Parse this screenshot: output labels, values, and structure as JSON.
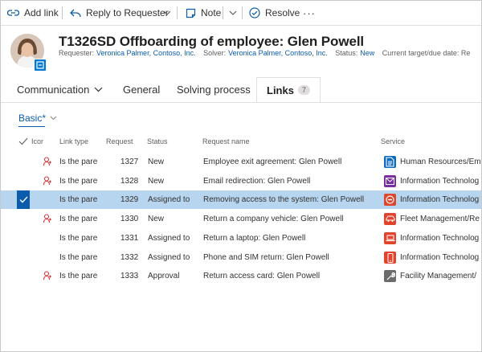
{
  "toolbar": {
    "add_link": "Add link",
    "reply": "Reply to Requester",
    "note": "Note",
    "resolve": "Resolve",
    "more": "···"
  },
  "header": {
    "title": "T1326SD Offboarding of employee: Glen Powell",
    "requester_label": "Requester:",
    "requester": "Veronica Palmer, Contoso, Inc.",
    "solver_label": "Solver:",
    "solver": "Veronica Palmer, Contoso, Inc.",
    "status_label": "Status:",
    "status": "New",
    "target_label": "Current target/due date: Re"
  },
  "tabs": [
    {
      "label": "Communication"
    },
    {
      "label": "General"
    },
    {
      "label": "Solving process"
    },
    {
      "label": "Links",
      "badge": "7"
    }
  ],
  "view": {
    "label": "Basic*"
  },
  "columns": {
    "icon": "Icor",
    "link_type": "Link type",
    "request": "Request",
    "status": "Status",
    "request_name": "Request name",
    "service": "Service"
  },
  "rows": [
    {
      "person": true,
      "link_type": "Is the pare",
      "request": "1327",
      "status": "New",
      "name": "Employee exit agreement: Glen Powell",
      "service": "Human Resources/Em",
      "service_icon": "document-icon",
      "service_color": "#0f6cbd"
    },
    {
      "person": true,
      "link_type": "Is the pare",
      "request": "1328",
      "status": "New",
      "name": "Email redirection: Glen Powell",
      "service": "Information Technolog",
      "service_icon": "mail-icon",
      "service_color": "#7a2ea0"
    },
    {
      "person": false,
      "selected": true,
      "link_type": "Is the pare",
      "request": "1329",
      "status": "Assigned to",
      "name": "Removing access to the system: Glen Powell",
      "service": "Information Technolog",
      "service_icon": "no-entry-icon",
      "service_color": "#e0442d"
    },
    {
      "person": true,
      "link_type": "Is the pare",
      "request": "1330",
      "status": "New",
      "name": "Return a company vehicle: Glen Powell",
      "service": "Fleet Management/Re",
      "service_icon": "car-icon",
      "service_color": "#e0442d"
    },
    {
      "person": false,
      "link_type": "Is the pare",
      "request": "1331",
      "status": "Assigned to",
      "name": "Return a laptop: Glen Powell",
      "service": "Information Technolog",
      "service_icon": "laptop-icon",
      "service_color": "#e0442d"
    },
    {
      "person": false,
      "link_type": "Is the pare",
      "request": "1332",
      "status": "Assigned to",
      "name": "Phone and SIM return: Glen Powell",
      "service": "Information Technolog",
      "service_icon": "phone-icon",
      "service_color": "#e0442d"
    },
    {
      "person": true,
      "link_type": "Is the pare",
      "request": "1333",
      "status": "Approval",
      "name": "Return access card: Glen Powell",
      "service": "Facility Management/",
      "service_icon": "wrench-icon",
      "service_color": "#6b6b6b"
    }
  ],
  "colors": {
    "accent": "#0b5cad",
    "selected_row": "#b7d5ee",
    "person_icon": "#d13438"
  }
}
